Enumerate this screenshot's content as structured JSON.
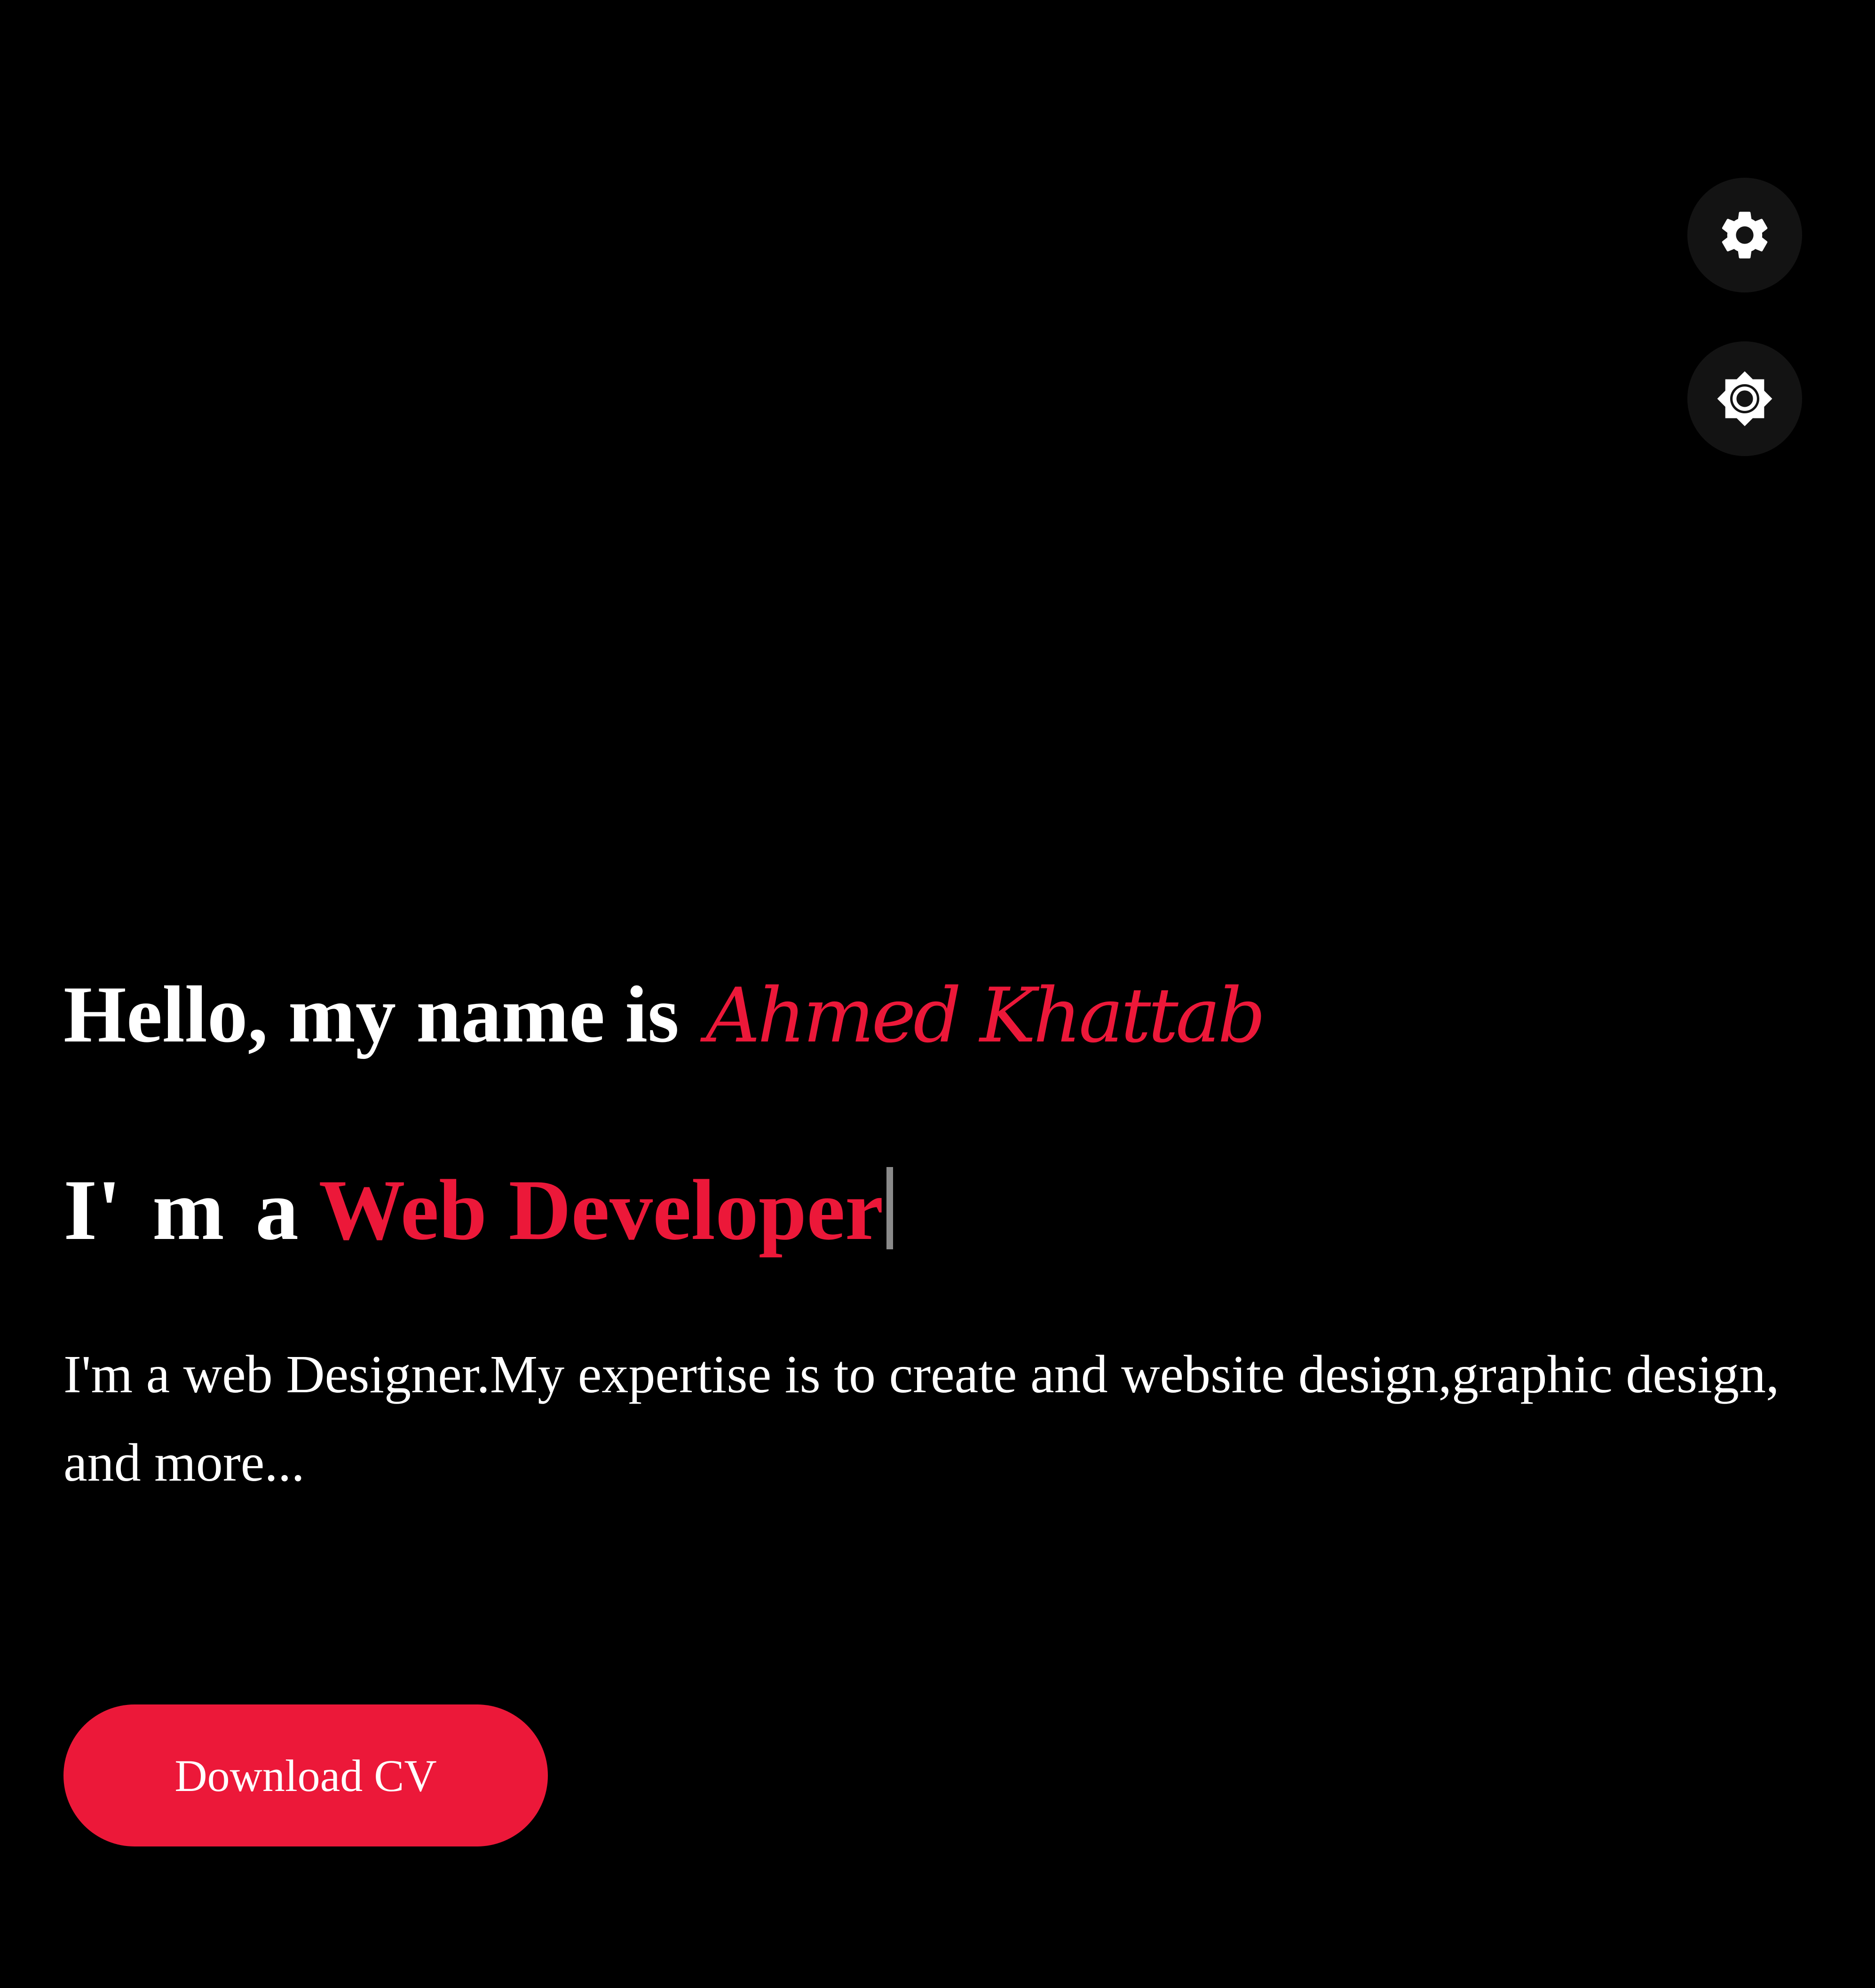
{
  "controls": {
    "settings_icon": "gear-icon",
    "theme_icon": "sun-icon"
  },
  "hero": {
    "greeting": "Hello, my name is",
    "name": "Ahmed Khattab",
    "role_prefix": "I' m a",
    "role": "Web Developer",
    "description": "I'm a web Designer.My expertise is to create and website design,graphic design, and more...",
    "download_label": "Download CV"
  },
  "colors": {
    "background": "#000000",
    "accent": "#ec1839",
    "icon_button_bg": "#131313",
    "text": "#ffffff"
  }
}
